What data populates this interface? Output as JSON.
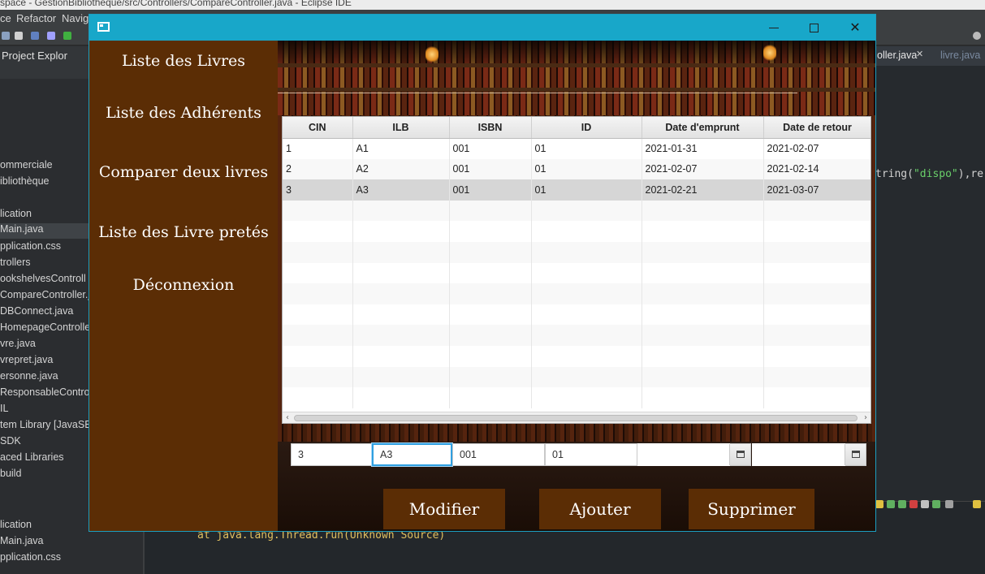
{
  "eclipse": {
    "title": "space - GestionBibliotheque/src/Controllers/CompareController.java - Eclipse IDE",
    "menu": [
      "ce",
      "Refactor",
      "Navig"
    ],
    "explorer_title": "Project Explor",
    "tree_items": [
      "ommerciale",
      "ibliothèque",
      "lication",
      "Main.java",
      "pplication.css",
      "trollers",
      "ookshelvesControll",
      "CompareController.ja",
      "DBConnect.java",
      "HomepageControlle",
      "vre.java",
      "vrepret.java",
      "ersonne.java",
      "ResponsableControll",
      "IL",
      "tem Library [JavaSE",
      "SDK",
      "aced Libraries",
      "build"
    ],
    "tree_items_bottom": [
      "lication",
      "Main.java",
      "pplication.css"
    ],
    "editor_tabs": [
      "oller.java",
      "livre.java"
    ],
    "code_fragment_pre": "tring(",
    "code_fragment_str": "\"dispo\"",
    "code_fragment_post": "),re",
    "console_line": "at java.lang.Thread.run(Unknown Source)"
  },
  "app": {
    "sidebar": [
      "Liste des Livres",
      "Liste des Adhérents",
      "Comparer deux livres",
      "Liste des Livre pretés",
      "Déconnexion"
    ],
    "table": {
      "columns": [
        "CIN",
        "ILB",
        "ISBN",
        "ID",
        "Date d'emprunt",
        "Date de retour"
      ],
      "rows": [
        [
          "1",
          "A1",
          "001",
          "01",
          "2021-01-31",
          "2021-02-07"
        ],
        [
          "2",
          "A2",
          "001",
          "01",
          "2021-02-07",
          "2021-02-14"
        ],
        [
          "3",
          "A3",
          "001",
          "01",
          "2021-02-21",
          "2021-03-07"
        ]
      ],
      "empty_rows": 10,
      "selected_row": 3
    },
    "form": {
      "cin": "3",
      "ilb": "A3",
      "isbn": "001",
      "id": "01",
      "date_emprunt": "",
      "date_retour": ""
    },
    "buttons": {
      "modify": "Modifier",
      "add": "Ajouter",
      "delete": "Supprimer"
    },
    "colors": {
      "titlebar": "#18a7c9",
      "sidebar": "#5b2d05",
      "button": "#5b2d05",
      "selected_row": "#d6d6d6",
      "focus_border": "#2f9fe0"
    }
  }
}
